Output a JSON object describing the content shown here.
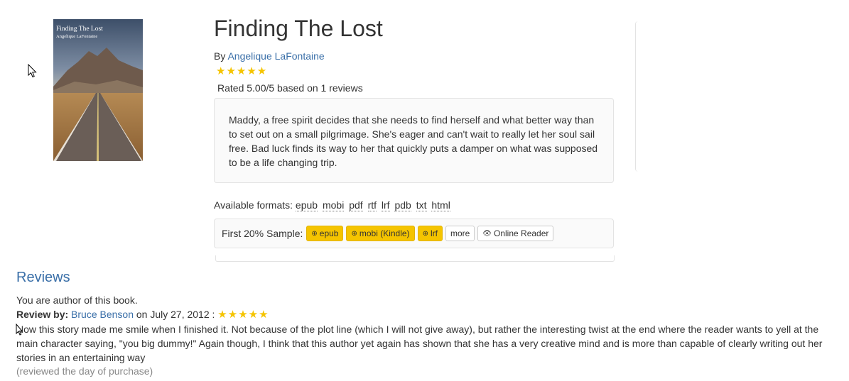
{
  "book": {
    "title": "Finding The Lost",
    "by_prefix": "By",
    "author": "Angelique LaFontaine",
    "stars": "★★★★★",
    "rating_text": "Rated 5.00/5 based on 1 reviews",
    "description": "Maddy, a free spirit decides that she needs to find herself and what better way than to set out on a small pilgrimage. She's eager and can't wait to really let her soul sail free. Bad luck finds its way to her that quickly puts a damper on what was supposed to be a life changing trip."
  },
  "cover": {
    "title": "Finding The Lost",
    "author": "Angelique LaFontaine"
  },
  "formats": {
    "label": "Available formats:",
    "items": [
      "epub",
      "mobi",
      "pdf",
      "rtf",
      "lrf",
      "pdb",
      "txt",
      "html"
    ]
  },
  "sample": {
    "label": "First 20% Sample:",
    "buttons": {
      "epub": "epub",
      "mobi": "mobi (Kindle)",
      "lrf": "lrf",
      "more": "more",
      "reader": "Online Reader"
    }
  },
  "reviews": {
    "heading": "Reviews",
    "author_note": "You are author of this book.",
    "items": [
      {
        "by_label": "Review by:",
        "reviewer": "Bruce Benson",
        "date_text": "on July 27, 2012 :",
        "stars": "★★★★★",
        "text": "Now this story made me smile when I finished it. Not because of the plot line (which I will not give away), but rather the interesting twist at the end where the reader wants to yell at the main character saying, \"you big dummy!\" Again though, I think that this author yet again has shown that she has a very creative mind and is more than capable of clearly writing out her stories in an entertaining way",
        "when": "(reviewed the day of purchase)"
      }
    ]
  },
  "colors": {
    "link": "#3a6fa8",
    "star": "#f5c400",
    "button_yellow": "#f5c400"
  }
}
